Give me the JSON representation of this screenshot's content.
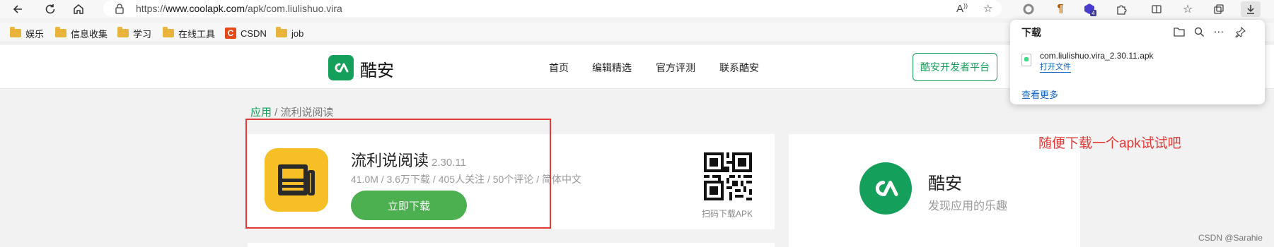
{
  "browser": {
    "url_scheme": "https://",
    "url_host": "www.coolapk.com",
    "url_path": "/apk/com.liulishuo.vira",
    "extension_badge": "4"
  },
  "bookmarks": [
    {
      "label": "娱乐",
      "icon": "folder-icon"
    },
    {
      "label": "信息收集",
      "icon": "folder-icon"
    },
    {
      "label": "学习",
      "icon": "folder-icon"
    },
    {
      "label": "在线工具",
      "icon": "folder-icon"
    },
    {
      "label": "CSDN",
      "icon": "csdn-icon"
    },
    {
      "label": "job",
      "icon": "folder-icon"
    }
  ],
  "site": {
    "logo_text": "酷安",
    "nav": [
      "首页",
      "编辑精选",
      "官方评测",
      "联系酷安"
    ],
    "dev_button": "酷安开发者平台"
  },
  "breadcrumb": {
    "link": "应用",
    "separator": " / ",
    "current": "流利说阅读"
  },
  "app": {
    "name": "流利说阅读",
    "version": "2.30.11",
    "meta": "41.0M / 3.6万下载 / 405人关注 / 50个评论 / 简体中文",
    "download_button": "立即下载",
    "qr_label": "扫码下载APK"
  },
  "side_card": {
    "title": "酷安",
    "subtitle": "发现应用的乐趣"
  },
  "downloads_panel": {
    "title": "下载",
    "file_name": "com.liulishuo.vira_2.30.11.apk",
    "open_file": "打开文件",
    "see_more": "查看更多"
  },
  "annotation": "随便下载一个apk试试吧",
  "watermark": "CSDN @Sarahie",
  "colors": {
    "brand_green": "#14a05b",
    "download_green": "#4caf50",
    "app_icon_yellow": "#f6bf26",
    "annotation_red": "#e53935",
    "link_blue": "#0b61c4"
  }
}
